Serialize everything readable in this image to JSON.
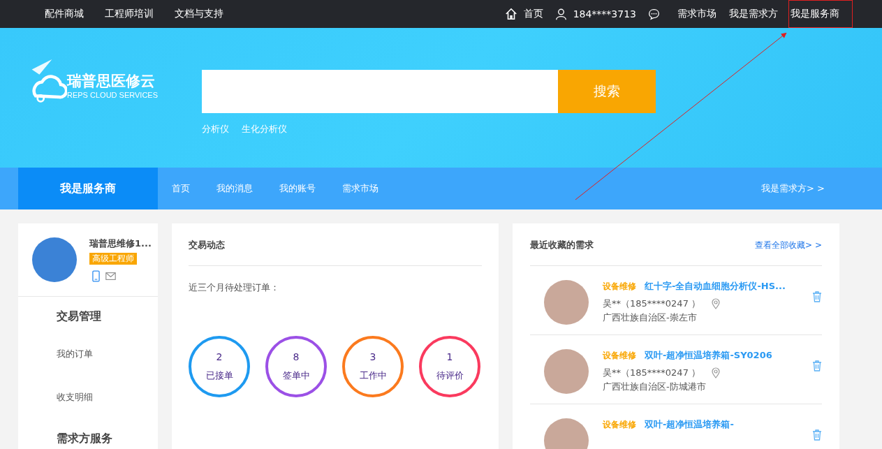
{
  "top_bar": {
    "left_links": [
      "配件商城",
      "工程师培训",
      "文档与支持"
    ],
    "home": "首页",
    "phone": "184****3713",
    "right_links": [
      {
        "label": "需求市场",
        "highlighted": false
      },
      {
        "label": "我是需求方",
        "highlighted": false
      },
      {
        "label": "我是服务商",
        "highlighted": true
      }
    ]
  },
  "logo": {
    "name": "瑞普思医修云",
    "subtitle": "REPS CLOUD SERVICES"
  },
  "search": {
    "button": "搜索",
    "hot_words": [
      "分析仪",
      "生化分析仪"
    ]
  },
  "nav": {
    "title": "我是服务商",
    "items": [
      "首页",
      "我的消息",
      "我的账号",
      "需求市场"
    ],
    "switch": "我是需求方> >"
  },
  "profile": {
    "name": "瑞普思维修1...",
    "badge": "高级工程师"
  },
  "sidebar": [
    {
      "kind": "heading",
      "label": "交易管理"
    },
    {
      "kind": "link",
      "label": "我的订单"
    },
    {
      "kind": "link",
      "label": "收支明细"
    },
    {
      "kind": "heading",
      "label": "需求方服务"
    }
  ],
  "trade": {
    "title": "交易动态",
    "subtitle": "近三个月待处理订单：",
    "stats": [
      {
        "count": "2",
        "label": "已接单",
        "color": "#1e9af0"
      },
      {
        "count": "8",
        "label": "签单中",
        "color": "#9b50e6"
      },
      {
        "count": "3",
        "label": "工作中",
        "color": "#fb7a1e"
      },
      {
        "count": "1",
        "label": "待评价",
        "color": "#fa3a5e"
      }
    ]
  },
  "favorites": {
    "title": "最近收藏的需求",
    "view_all": "查看全部收藏> >",
    "items": [
      {
        "tag": "设备维修",
        "title": "红十字-全自动血细胞分析仪-HS...",
        "contact": "吴**（185****0247 ）",
        "location": "广西壮族自治区-崇左市"
      },
      {
        "tag": "设备维修",
        "title": "双叶-超净恒温培养箱-SY0206",
        "contact": "吴**（185****0247 ）",
        "location": "广西壮族自治区-防城港市"
      },
      {
        "tag": "设备维修",
        "title": "双叶-超净恒温培养箱-"
      }
    ]
  }
}
